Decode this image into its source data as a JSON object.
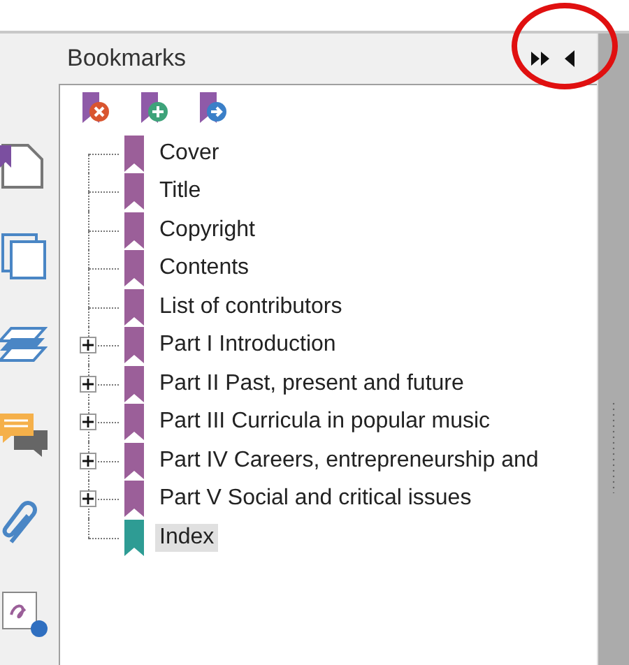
{
  "panel": {
    "title": "Bookmarks"
  },
  "tree": [
    {
      "label": "Cover",
      "expandable": false,
      "selected": false,
      "color": "#9b5f99"
    },
    {
      "label": "Title",
      "expandable": false,
      "selected": false,
      "color": "#9b5f99"
    },
    {
      "label": "Copyright",
      "expandable": false,
      "selected": false,
      "color": "#9b5f99"
    },
    {
      "label": "Contents",
      "expandable": false,
      "selected": false,
      "color": "#9b5f99"
    },
    {
      "label": "List of contributors",
      "expandable": false,
      "selected": false,
      "color": "#9b5f99"
    },
    {
      "label": "Part I Introduction",
      "expandable": true,
      "selected": false,
      "color": "#9b5f99"
    },
    {
      "label": "Part II Past, present and future",
      "expandable": true,
      "selected": false,
      "color": "#9b5f99"
    },
    {
      "label": "Part III Curricula in popular music",
      "expandable": true,
      "selected": false,
      "color": "#9b5f99"
    },
    {
      "label": "Part IV Careers, entrepreneurship and",
      "expandable": true,
      "selected": false,
      "color": "#9b5f99"
    },
    {
      "label": "Part V Social and critical issues",
      "expandable": true,
      "selected": false,
      "color": "#9b5f99"
    },
    {
      "label": "Index",
      "expandable": false,
      "selected": true,
      "color": "#2e9c94"
    }
  ]
}
